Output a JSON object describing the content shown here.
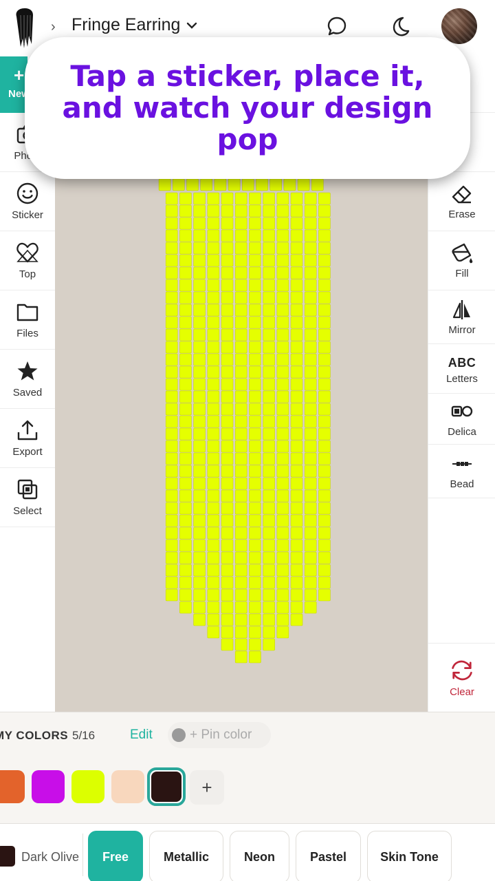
{
  "header": {
    "crumb_separator": "›",
    "title": "Fringe Earring"
  },
  "left_tools": [
    {
      "label": "New",
      "icon": "plus-icon"
    },
    {
      "label": "Photo",
      "icon": "camera-icon"
    },
    {
      "label": "Sticker",
      "icon": "smiley-icon"
    },
    {
      "label": "Top",
      "icon": "heart-icon"
    },
    {
      "label": "Files",
      "icon": "folder-icon"
    },
    {
      "label": "Saved",
      "icon": "star-icon"
    },
    {
      "label": "Export",
      "icon": "upload-icon"
    },
    {
      "label": "Select",
      "icon": "select-icon"
    }
  ],
  "right_tools": [
    {
      "label": "Erase",
      "icon": "eraser-icon"
    },
    {
      "label": "Fill",
      "icon": "paint-bucket-icon"
    },
    {
      "label": "Mirror",
      "icon": "mirror-icon"
    },
    {
      "label": "Letters",
      "icon": "abc-icon",
      "glyph": "ABC"
    },
    {
      "label": "Delica",
      "icon": "delica-icon"
    },
    {
      "label": "Bead",
      "icon": "bead-icon"
    }
  ],
  "clear_label": "Clear",
  "tooltip": {
    "text": "Tap a sticker, place it, and watch your design pop"
  },
  "pattern": {
    "bead_color": "#e5ff00",
    "background": "#d7d0c7",
    "column_lengths": [
      0,
      33,
      34,
      35,
      36,
      37,
      38,
      38,
      37,
      36,
      35,
      34,
      33
    ],
    "top_row_count": 12
  },
  "colors_panel": {
    "label": "MY COLORS",
    "count": "5/16",
    "edit_label": "Edit",
    "pin_label": "+ Pin color",
    "swatches": [
      {
        "color": "#e3632b"
      },
      {
        "color": "#c80ee8"
      },
      {
        "color": "#dcff00"
      },
      {
        "color": "#f8d7bd"
      },
      {
        "color": "#2a1412",
        "selected": true
      }
    ],
    "add_label": "+"
  },
  "bottom": {
    "current_color_name": "Dark Olive",
    "current_color": "#2a1412",
    "tabs": [
      "Free",
      "Metallic",
      "Neon",
      "Pastel",
      "Skin Tone"
    ],
    "active_tab": "Free"
  }
}
